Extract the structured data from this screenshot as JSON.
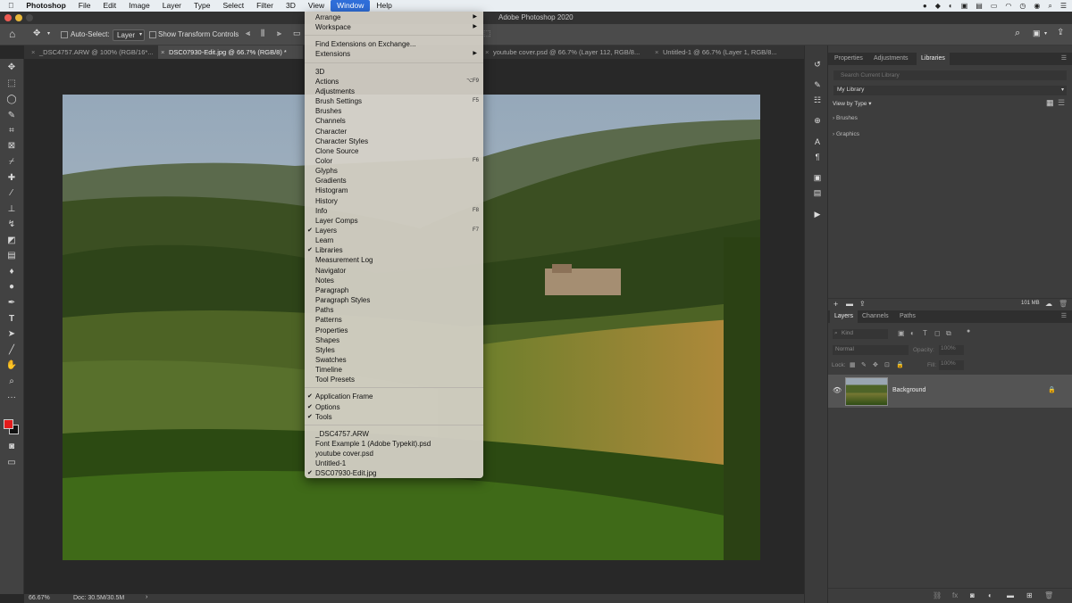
{
  "menubar": {
    "app": "Photoshop",
    "items": [
      "File",
      "Edit",
      "Image",
      "Layer",
      "Type",
      "Select",
      "Filter",
      "3D",
      "View",
      "Window",
      "Help"
    ],
    "active": "Window"
  },
  "titlebar": {
    "title": "Adobe Photoshop 2020"
  },
  "options": {
    "auto_select": "Auto-Select:",
    "layer_select": "Layer",
    "show_transform": "Show Transform Controls"
  },
  "tabs": [
    {
      "label": "_DSC4757.ARW @ 100% (RGB/16*...",
      "active": false
    },
    {
      "label": "DSC07930-Edit.jpg @ 66.7% (RGB/8) *",
      "active": true
    },
    {
      "label": "youtube cover.psd @ 66.7% (Layer 112, RGB/8...",
      "active": false
    },
    {
      "label": "Untitled-1 @ 66.7% (Layer 1, RGB/8...",
      "active": false
    }
  ],
  "status": {
    "zoom": "66.67%",
    "doc": "Doc: 30.5M/30.5M",
    "arrow": "›"
  },
  "window_menu": {
    "top": [
      {
        "label": "Arrange",
        "submenu": true
      },
      {
        "label": "Workspace",
        "submenu": true
      }
    ],
    "ext": [
      {
        "label": "Find Extensions on Exchange..."
      },
      {
        "label": "Extensions",
        "submenu": true
      }
    ],
    "panels": [
      {
        "label": "3D"
      },
      {
        "label": "Actions",
        "shortcut": "⌥F9"
      },
      {
        "label": "Adjustments"
      },
      {
        "label": "Brush Settings",
        "shortcut": "F5"
      },
      {
        "label": "Brushes"
      },
      {
        "label": "Channels"
      },
      {
        "label": "Character"
      },
      {
        "label": "Character Styles"
      },
      {
        "label": "Clone Source"
      },
      {
        "label": "Color",
        "shortcut": "F6"
      },
      {
        "label": "Glyphs"
      },
      {
        "label": "Gradients"
      },
      {
        "label": "Histogram"
      },
      {
        "label": "History"
      },
      {
        "label": "Info",
        "shortcut": "F8"
      },
      {
        "label": "Layer Comps"
      },
      {
        "label": "Layers",
        "shortcut": "F7",
        "checked": true
      },
      {
        "label": "Learn"
      },
      {
        "label": "Libraries",
        "checked": true
      },
      {
        "label": "Measurement Log"
      },
      {
        "label": "Navigator"
      },
      {
        "label": "Notes"
      },
      {
        "label": "Paragraph"
      },
      {
        "label": "Paragraph Styles"
      },
      {
        "label": "Paths"
      },
      {
        "label": "Patterns"
      },
      {
        "label": "Properties"
      },
      {
        "label": "Shapes"
      },
      {
        "label": "Styles"
      },
      {
        "label": "Swatches"
      },
      {
        "label": "Timeline"
      },
      {
        "label": "Tool Presets"
      }
    ],
    "frames": [
      {
        "label": "Application Frame",
        "checked": true
      },
      {
        "label": "Options",
        "checked": true
      },
      {
        "label": "Tools",
        "checked": true
      }
    ],
    "docs": [
      {
        "label": "_DSC4757.ARW"
      },
      {
        "label": "Font Example 1 (Adobe Typekit).psd"
      },
      {
        "label": "youtube cover.psd"
      },
      {
        "label": "Untitled-1"
      },
      {
        "label": "DSC07930-Edit.jpg",
        "checked": true
      }
    ]
  },
  "libraries_panel": {
    "tabs": [
      "Properties",
      "Adjustments",
      "Libraries"
    ],
    "active_tab": "Libraries",
    "search_placeholder": "Search Current Library",
    "library": "My Library",
    "view_by": "View by Type",
    "groups": [
      "Brushes",
      "Graphics"
    ],
    "storage": "101 MB"
  },
  "layers_panel": {
    "tabs": [
      "Layers",
      "Channels",
      "Paths"
    ],
    "active_tab": "Layers",
    "kind_placeholder": "Kind",
    "blend": "Normal",
    "opacity_label": "Opacity:",
    "opacity_value": "100%",
    "lock_label": "Lock:",
    "fill_label": "Fill:",
    "fill_value": "100%",
    "layers": [
      {
        "name": "Background",
        "visible": true,
        "locked": true
      }
    ]
  },
  "colors": {
    "accent": "#2f6ed9",
    "foreground": "#e31b1b",
    "background": "#111111"
  }
}
